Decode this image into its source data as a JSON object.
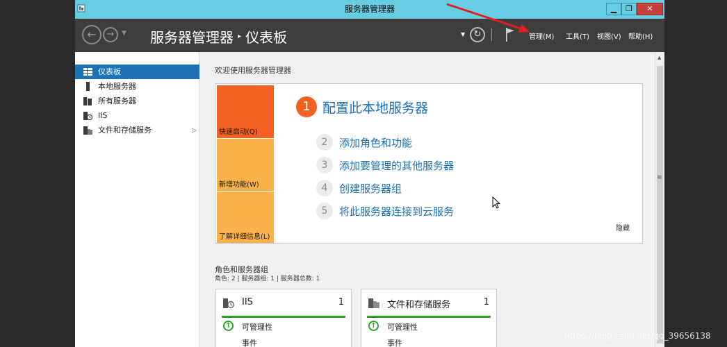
{
  "window": {
    "title": "服务器管理器",
    "controls": {
      "minimize": "▁",
      "maximize": "❐",
      "close": "✕"
    }
  },
  "toolbar": {
    "breadcrumb_root": "服务器管理器",
    "breadcrumb_sep": "▸",
    "breadcrumb_page": "仪表板",
    "menus": [
      "管理(M)",
      "工具(T)",
      "视图(V)",
      "帮助(H)"
    ]
  },
  "sidebar": {
    "items": [
      {
        "label": "仪表板",
        "icon": "dashboard-icon",
        "active": true
      },
      {
        "label": "本地服务器",
        "icon": "local-server-icon",
        "active": false
      },
      {
        "label": "所有服务器",
        "icon": "all-servers-icon",
        "active": false
      },
      {
        "label": "IIS",
        "icon": "iis-icon",
        "active": false
      },
      {
        "label": "文件和存储服务",
        "icon": "file-storage-icon",
        "active": false,
        "expand": "▷"
      }
    ]
  },
  "welcome": {
    "title": "欢迎使用服务器管理器",
    "tiles": [
      "快速启动(Q)",
      "新增功能(W)",
      "了解详细信息(L)"
    ],
    "steps": [
      {
        "num": "1",
        "label": "配置此本地服务器"
      },
      {
        "num": "2",
        "label": "添加角色和功能"
      },
      {
        "num": "3",
        "label": "添加要管理的其他服务器"
      },
      {
        "num": "4",
        "label": "创建服务器组"
      },
      {
        "num": "5",
        "label": "将此服务器连接到云服务"
      }
    ],
    "hide": "隐藏"
  },
  "roles": {
    "title": "角色和服务器组",
    "subtitle": "角色: 2 | 服务器组: 1 | 服务器总数: 1",
    "cards": [
      {
        "name": "IIS",
        "count": "1",
        "manageability": "可管理性",
        "events": "事件",
        "icon": "iis-icon"
      },
      {
        "name": "文件和存储服务",
        "count": "1",
        "manageability": "可管理性",
        "events": "事件",
        "icon": "file-storage-icon"
      }
    ]
  },
  "watermark": "https://blog.csdn.net/qq_39656138",
  "colors": {
    "titlebar": "#67cde3",
    "accent_blue": "#1e72b6",
    "quick_start": "#f26122",
    "tile_yellow": "#fbb14b",
    "status_green": "#2ca02c"
  }
}
